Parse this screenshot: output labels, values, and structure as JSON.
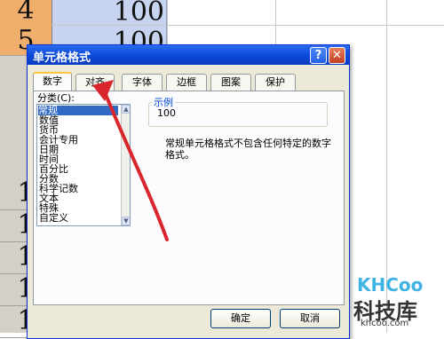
{
  "spreadsheet": {
    "rows": [
      {
        "num": "4",
        "value": "100"
      },
      {
        "num": "5",
        "value": "100"
      },
      {
        "num": "1",
        "value": ""
      },
      {
        "num": "1",
        "value": ""
      },
      {
        "num": "1",
        "value": ""
      },
      {
        "num": "1",
        "value": ""
      },
      {
        "num": "1",
        "value": ""
      }
    ]
  },
  "dialog": {
    "title": "单元格格式",
    "help_label": "?",
    "close_label": "✕",
    "tabs": [
      {
        "label": "数字",
        "active": true
      },
      {
        "label": "对齐",
        "active": false
      },
      {
        "label": "字体",
        "active": false
      },
      {
        "label": "边框",
        "active": false
      },
      {
        "label": "图案",
        "active": false
      },
      {
        "label": "保护",
        "active": false
      }
    ],
    "category_label": "分类(C):",
    "categories": [
      "常规",
      "数值",
      "货币",
      "会计专用",
      "日期",
      "时间",
      "百分比",
      "分数",
      "科学记数",
      "文本",
      "特殊",
      "自定义"
    ],
    "selected_category": "常规",
    "sample_label": "示例",
    "sample_value": "100",
    "description": "常规单元格格式不包含任何特定的数字格式。",
    "ok_label": "确定",
    "cancel_label": "取消"
  },
  "watermark": {
    "logo_text": "KHCoo",
    "site_name": "科技库",
    "url": "khcoo.com"
  },
  "colors": {
    "titlebar": "#0b4ad8",
    "selection": "#316ac5",
    "arrow": "#d9262c",
    "column_highlight": "#c6d4ef",
    "row_highlight": "#f0ae6c"
  }
}
